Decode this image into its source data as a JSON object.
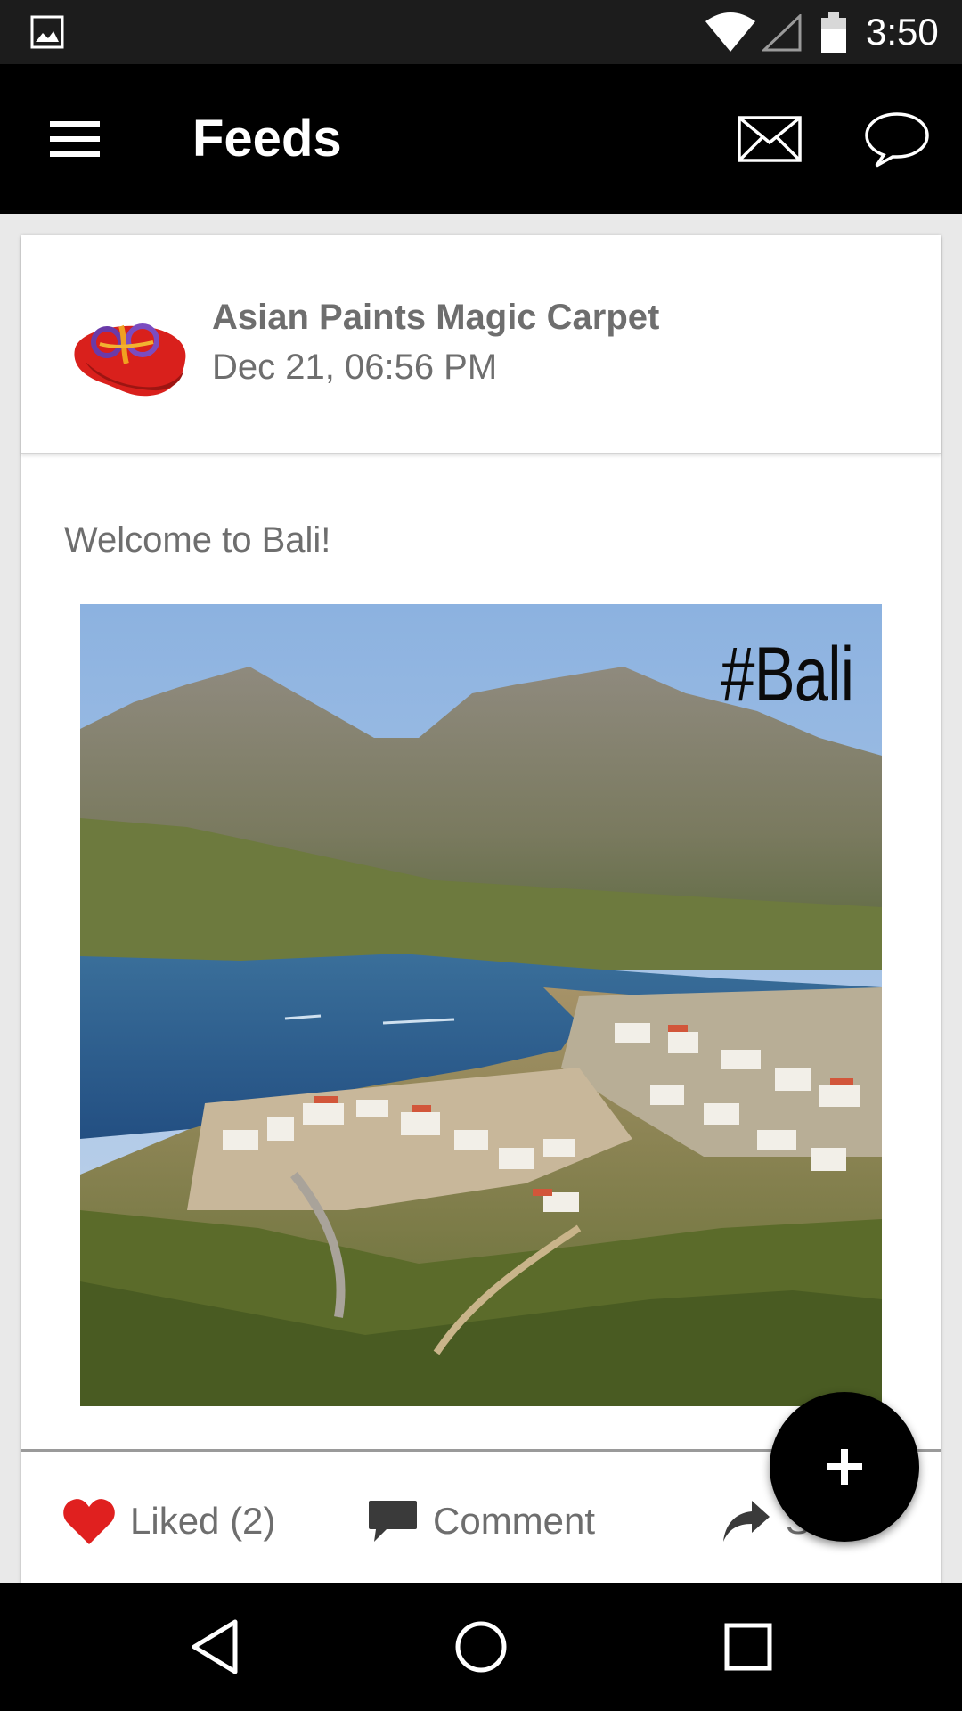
{
  "status_bar": {
    "time": "3:50",
    "icons": [
      "gallery-icon",
      "wifi-icon",
      "signal-icon",
      "battery-icon"
    ]
  },
  "app_bar": {
    "title": "Feeds",
    "icons": [
      "menu-icon",
      "mail-icon",
      "chat-icon"
    ]
  },
  "post": {
    "author": "Asian Paints Magic Carpet",
    "timestamp": "Dec 21, 06:56 PM",
    "text": "Welcome to Bali!",
    "image_hashtag": "#Bali",
    "actions": {
      "like_label": "Liked (2)",
      "comment_label": "Comment",
      "share_label": "Share"
    }
  },
  "fab": {
    "icon": "plus-icon"
  },
  "nav_bar": {
    "icons": [
      "back-icon",
      "home-icon",
      "recents-icon"
    ]
  },
  "colors": {
    "app_bar": "#000000",
    "status_bar": "#1c1c1c",
    "like_heart": "#e0201f",
    "text_gray": "#6e6e6e"
  }
}
